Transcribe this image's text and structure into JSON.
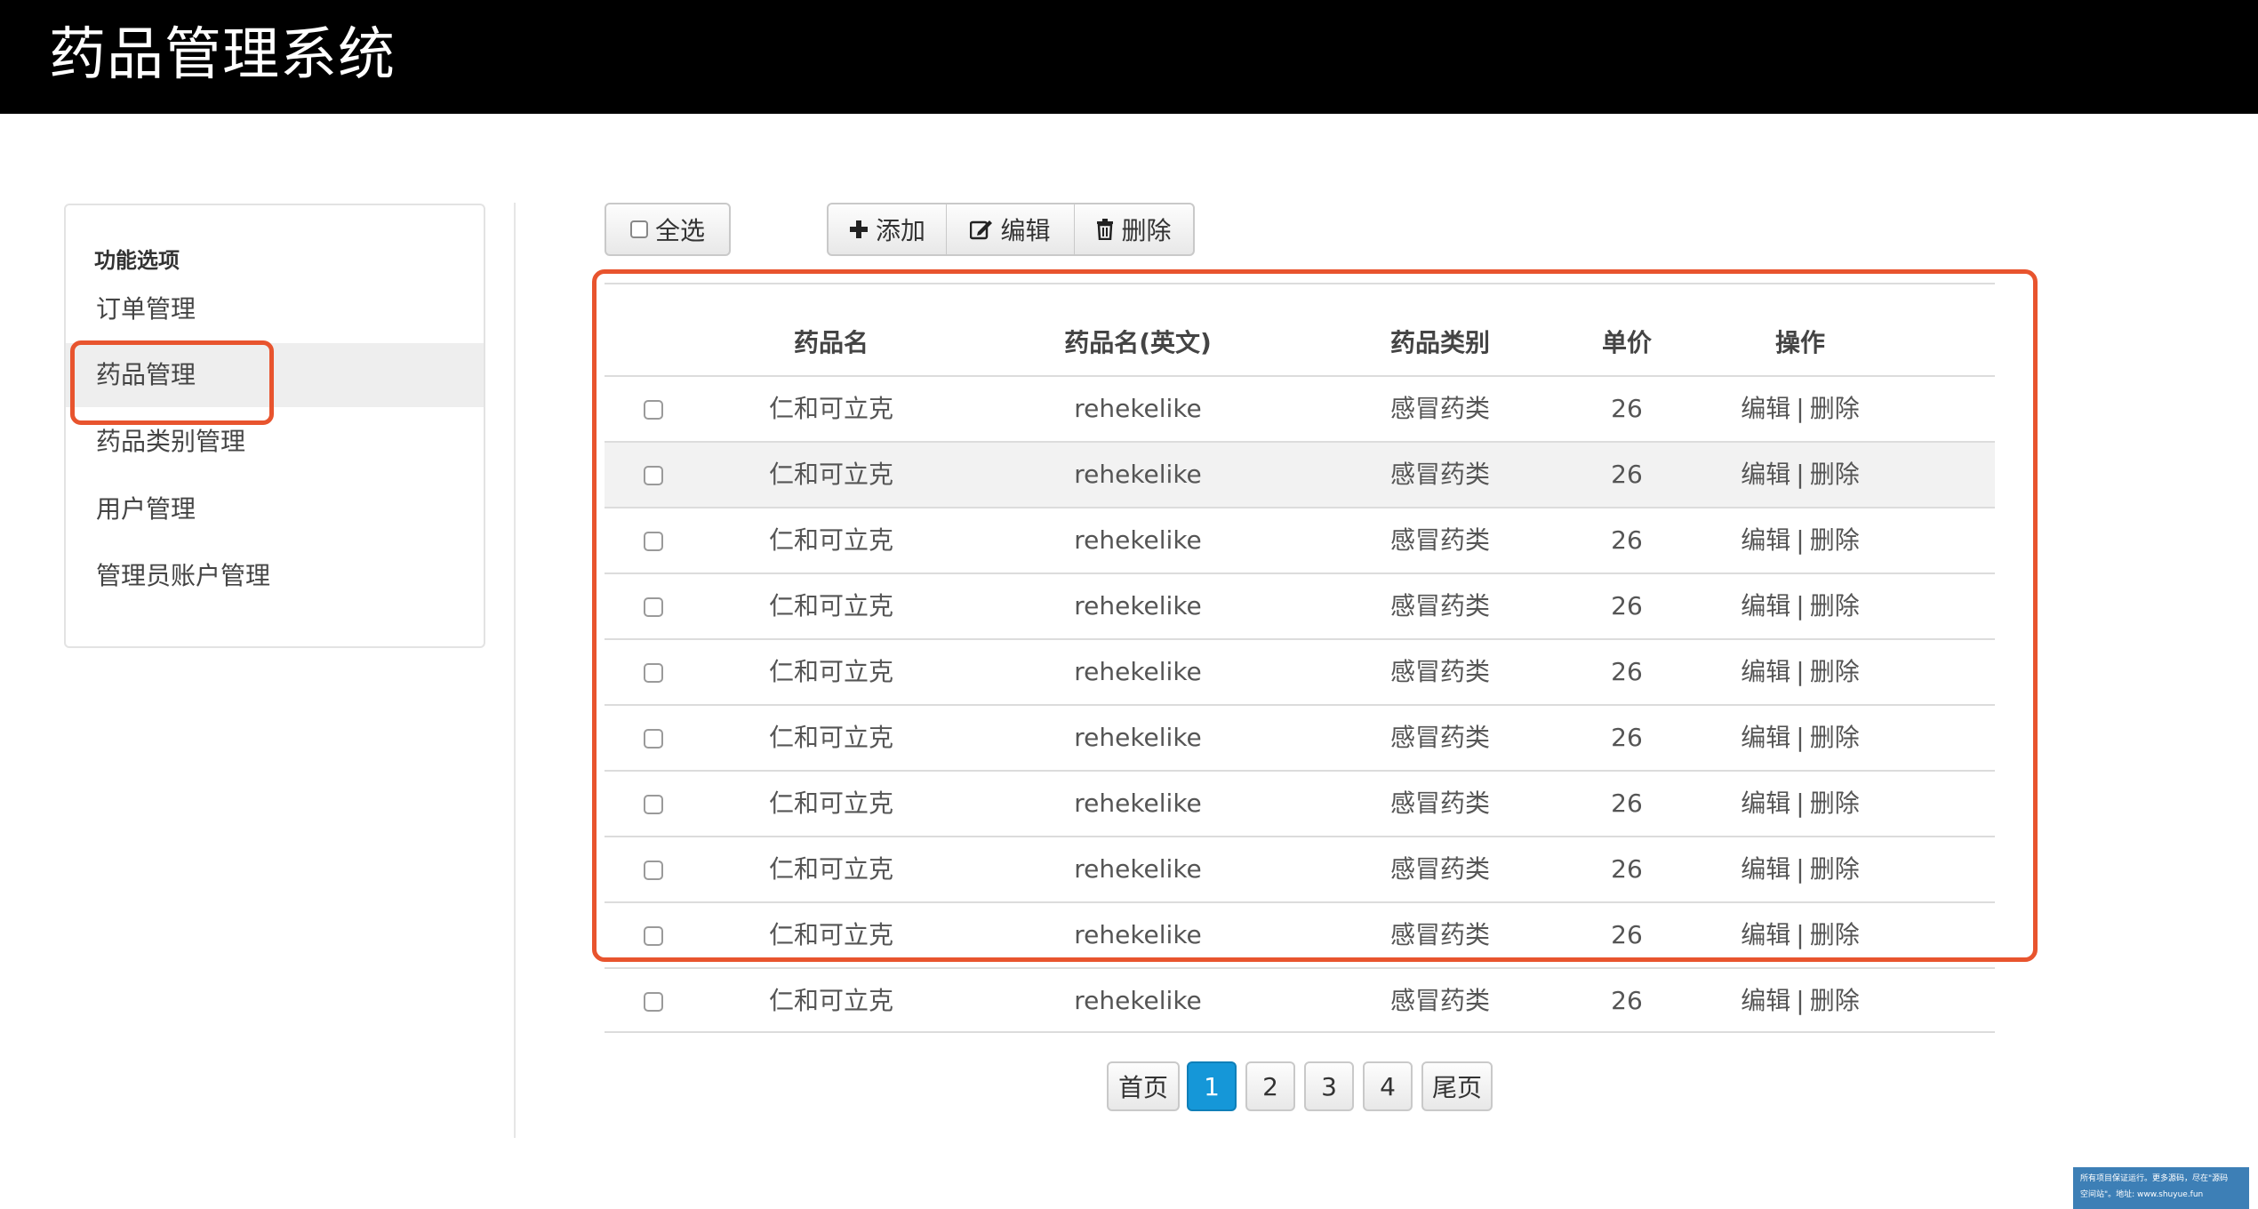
{
  "app": {
    "title": "药品管理系统"
  },
  "sidebar": {
    "header": "功能选项",
    "items": [
      {
        "label": "订单管理"
      },
      {
        "label": "药品管理",
        "active": true
      },
      {
        "label": "药品类别管理"
      },
      {
        "label": "用户管理"
      },
      {
        "label": "管理员账户管理"
      }
    ]
  },
  "toolbar": {
    "select_all": "全选",
    "add": "添加",
    "edit": "编辑",
    "delete": "删除"
  },
  "table": {
    "columns": [
      "药品名",
      "药品名(英文)",
      "药品类别",
      "单价",
      "操作"
    ],
    "rows": [
      {
        "name": "仁和可立克",
        "name_en": "rehekelike",
        "category": "感冒药类",
        "price": "26",
        "edit": "编辑",
        "sep": "|",
        "delete": "删除"
      },
      {
        "name": "仁和可立克",
        "name_en": "rehekelike",
        "category": "感冒药类",
        "price": "26",
        "edit": "编辑",
        "sep": "|",
        "delete": "删除"
      },
      {
        "name": "仁和可立克",
        "name_en": "rehekelike",
        "category": "感冒药类",
        "price": "26",
        "edit": "编辑",
        "sep": "|",
        "delete": "删除"
      },
      {
        "name": "仁和可立克",
        "name_en": "rehekelike",
        "category": "感冒药类",
        "price": "26",
        "edit": "编辑",
        "sep": "|",
        "delete": "删除"
      },
      {
        "name": "仁和可立克",
        "name_en": "rehekelike",
        "category": "感冒药类",
        "price": "26",
        "edit": "编辑",
        "sep": "|",
        "delete": "删除"
      },
      {
        "name": "仁和可立克",
        "name_en": "rehekelike",
        "category": "感冒药类",
        "price": "26",
        "edit": "编辑",
        "sep": "|",
        "delete": "删除"
      },
      {
        "name": "仁和可立克",
        "name_en": "rehekelike",
        "category": "感冒药类",
        "price": "26",
        "edit": "编辑",
        "sep": "|",
        "delete": "删除"
      },
      {
        "name": "仁和可立克",
        "name_en": "rehekelike",
        "category": "感冒药类",
        "price": "26",
        "edit": "编辑",
        "sep": "|",
        "delete": "删除"
      },
      {
        "name": "仁和可立克",
        "name_en": "rehekelike",
        "category": "感冒药类",
        "price": "26",
        "edit": "编辑",
        "sep": "|",
        "delete": "删除"
      },
      {
        "name": "仁和可立克",
        "name_en": "rehekelike",
        "category": "感冒药类",
        "price": "26",
        "edit": "编辑",
        "sep": "|",
        "delete": "删除"
      }
    ]
  },
  "pagination": {
    "first": "首页",
    "pages": [
      "1",
      "2",
      "3",
      "4"
    ],
    "current": "1",
    "last": "尾页"
  },
  "watermark": {
    "line1": "所有项目保证运行。更多源码，尽在\"源码",
    "line2": "空间站\"。地址: www.shuyue.fun"
  },
  "colors": {
    "topbar": "#000000",
    "highlight": "#e8542e",
    "active_page": "#1597d8",
    "active_row": "#f2f2f2"
  }
}
